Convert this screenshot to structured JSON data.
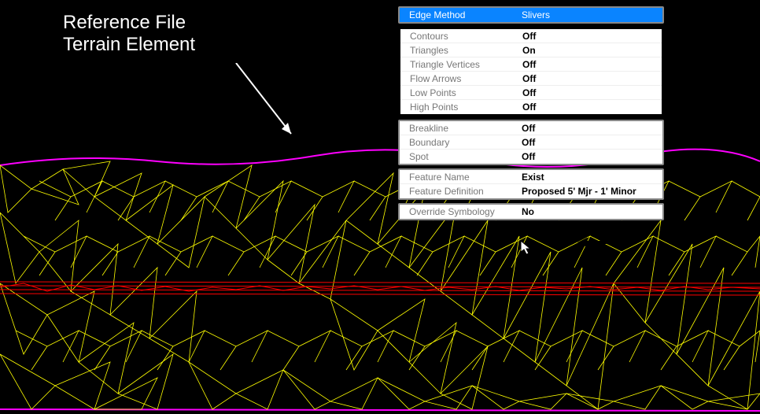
{
  "annotation": {
    "line1": "Reference File",
    "line2": "Terrain Element"
  },
  "panels": {
    "edge": {
      "edge_method_label": "Edge Method",
      "edge_method_value": "Slivers"
    },
    "display": {
      "contours_label": "Contours",
      "contours_value": "Off",
      "triangles_label": "Triangles",
      "triangles_value": "On",
      "triangle_vertices_label": "Triangle Vertices",
      "triangle_vertices_value": "Off",
      "flow_arrows_label": "Flow Arrows",
      "flow_arrows_value": "Off",
      "low_points_label": "Low Points",
      "low_points_value": "Off",
      "high_points_label": "High Points",
      "high_points_value": "Off"
    },
    "features": {
      "breakline_label": "Breakline",
      "breakline_value": "Off",
      "boundary_label": "Boundary",
      "boundary_value": "Off",
      "spot_label": "Spot",
      "spot_value": "Off"
    },
    "feature_def": {
      "feature_name_label": "Feature Name",
      "feature_name_value": "Exist",
      "feature_definition_label": "Feature Definition",
      "feature_definition_value": "Proposed 5' Mjr - 1' Minor"
    },
    "override": {
      "override_symbology_label": "Override Symbology",
      "override_symbology_value": "No"
    }
  }
}
